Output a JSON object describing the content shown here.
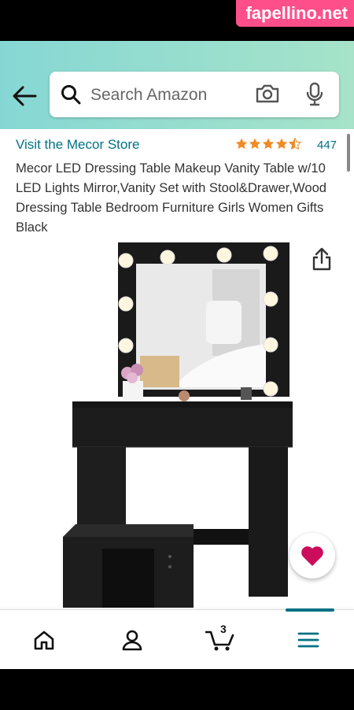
{
  "watermark": "fapellino.net",
  "search": {
    "placeholder": "Search Amazon"
  },
  "product": {
    "store_link": "Visit the Mecor Store",
    "rating": 4.5,
    "review_count": "447",
    "title": "Mecor LED Dressing Table Makeup Vanity Table w/10 LED Lights Mirror,Vanity Set with Stool&Drawer,Wood Dressing Table Bedroom Furniture Girls Women Gifts Black"
  },
  "bottom_nav": {
    "items": [
      "home-icon",
      "account-icon",
      "cart-icon",
      "menu-icon"
    ],
    "cart_count": "3"
  },
  "colors": {
    "accent": "#007185",
    "star": "#f08a24",
    "heart": "#cc0c5c",
    "header": "#8fdbd0"
  }
}
